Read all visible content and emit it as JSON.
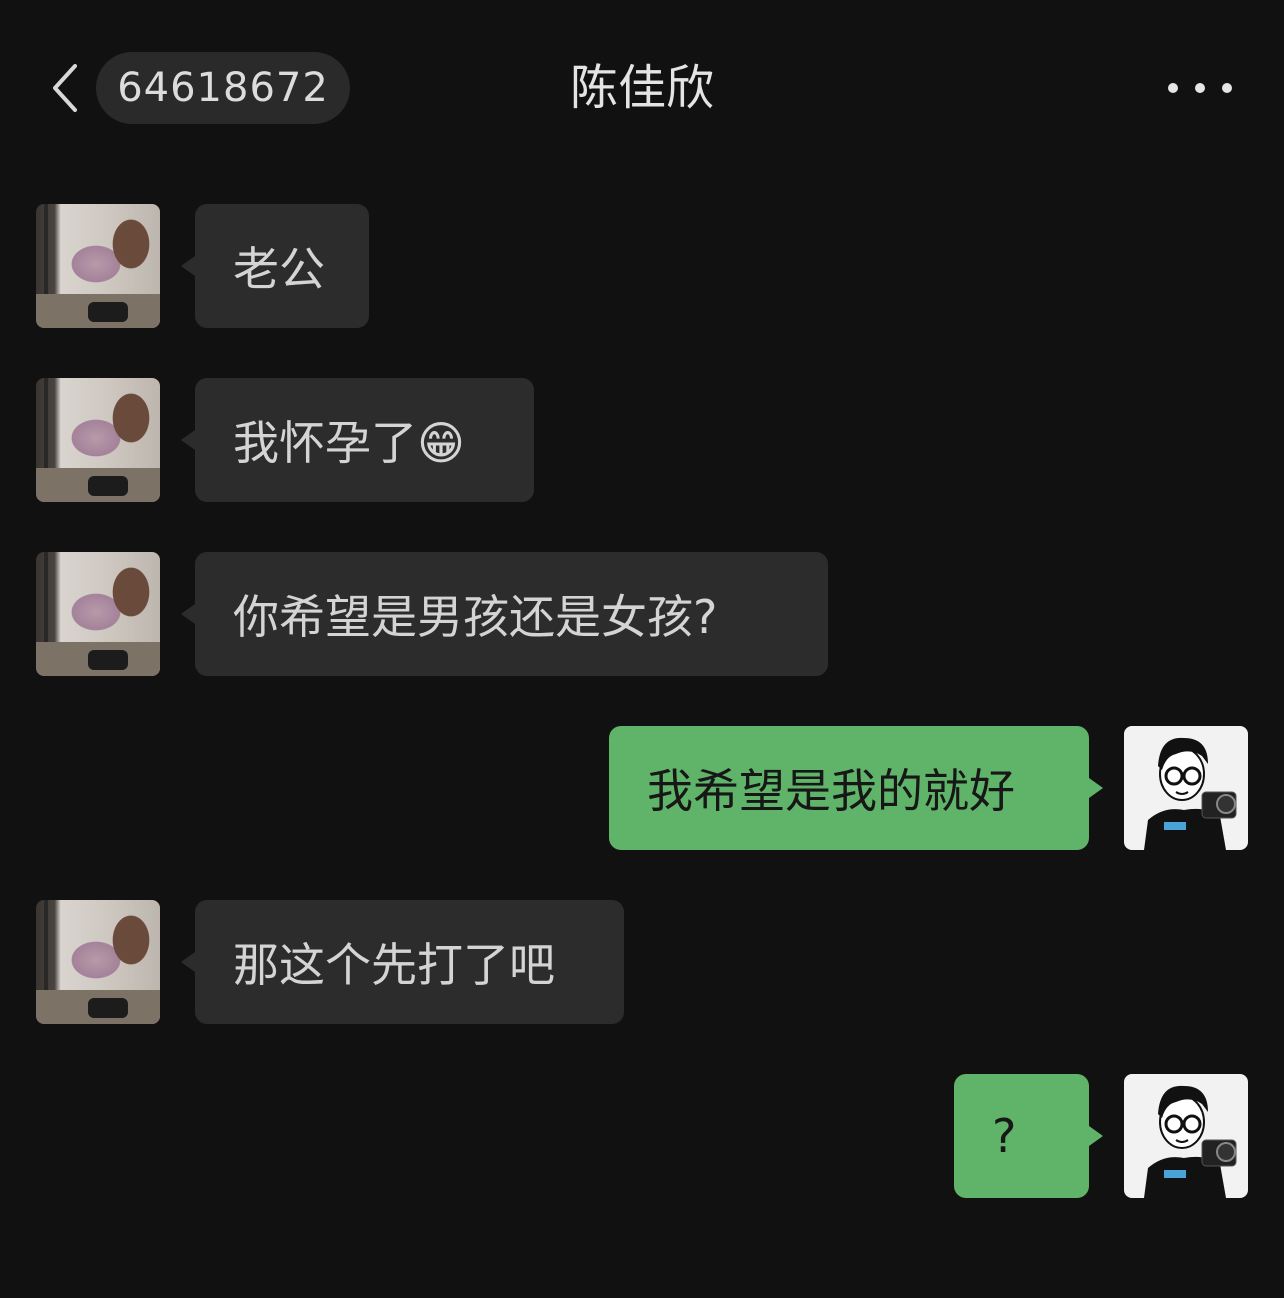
{
  "header": {
    "back_icon": "chevron-left-icon",
    "unread_count": "64618672",
    "title": "陈佳欣",
    "more_icon": "ellipsis-icon"
  },
  "messages": [
    {
      "side": "in",
      "text": "老公"
    },
    {
      "side": "in",
      "text": "我怀孕了😁"
    },
    {
      "side": "in",
      "text": "你希望是男孩还是女孩?"
    },
    {
      "side": "out",
      "text": "我希望是我的就好"
    },
    {
      "side": "in",
      "text": "那这个先打了吧"
    },
    {
      "side": "out",
      "text": "?"
    }
  ],
  "colors": {
    "background": "#111111",
    "incoming_bubble": "#2c2c2c",
    "outgoing_bubble": "#5fb46a"
  }
}
